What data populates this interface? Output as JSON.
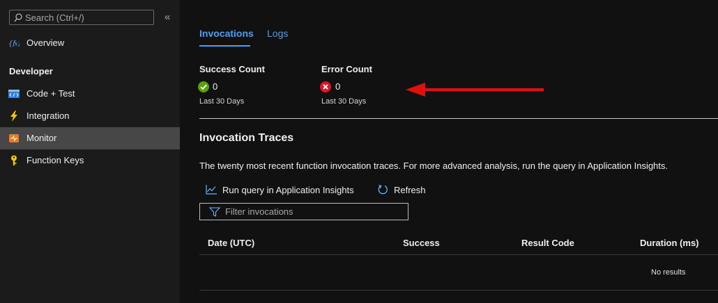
{
  "sidebar": {
    "search": {
      "placeholder": "Search (Ctrl+/)",
      "value": ""
    },
    "collapse_glyph": "«",
    "overview": {
      "label": "Overview",
      "icon": "function-icon"
    },
    "section_title": "Developer",
    "items": [
      {
        "label": "Code + Test",
        "icon": "code-icon",
        "active": false
      },
      {
        "label": "Integration",
        "icon": "lightning-icon",
        "active": false
      },
      {
        "label": "Monitor",
        "icon": "monitor-icon",
        "active": true
      },
      {
        "label": "Function Keys",
        "icon": "key-icon",
        "active": false
      }
    ]
  },
  "main": {
    "tabs": [
      {
        "label": "Invocations",
        "selected": true
      },
      {
        "label": "Logs",
        "selected": false
      }
    ],
    "metrics": [
      {
        "title": "Success Count",
        "value": "0",
        "period": "Last 30 Days",
        "status": "success"
      },
      {
        "title": "Error Count",
        "value": "0",
        "period": "Last 30 Days",
        "status": "error"
      }
    ],
    "traces": {
      "title": "Invocation Traces",
      "description": "The twenty most recent function invocation traces. For more advanced analysis, run the query in Application Insights.",
      "run_query_label": "Run query in Application Insights",
      "refresh_label": "Refresh",
      "filter_placeholder": "Filter invocations",
      "columns": [
        "Date (UTC)",
        "Success",
        "Result Code",
        "Duration (ms)"
      ],
      "empty_text": "No results"
    }
  },
  "colors": {
    "accent": "#4ba0f2",
    "success": "#57a300",
    "error": "#e81123",
    "annotation_arrow": "#e01010",
    "active_nav": "#474747"
  }
}
